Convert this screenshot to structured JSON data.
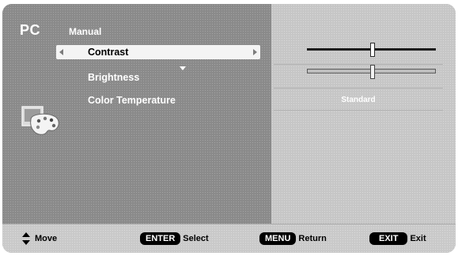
{
  "osd": {
    "source": "PC",
    "mode": "Manual",
    "menu_items": [
      {
        "label": "Contrast"
      },
      {
        "label": "Brightness"
      },
      {
        "label": "Color Temperature"
      }
    ],
    "sliders": [
      {
        "name": "contrast",
        "level_percent": 50,
        "active": true
      },
      {
        "name": "brightness",
        "level_percent": 50,
        "active": false
      }
    ],
    "color_temperature_value": "Standard"
  },
  "footer": {
    "move_label": "Move",
    "enter_key": "ENTER",
    "enter_label": "Select",
    "menu_key": "MENU",
    "menu_label": "Return",
    "exit_key": "EXIT",
    "exit_label": "Exit"
  },
  "icons": [
    "palette-icon",
    "up-down-arrow-icon",
    "arrow-left-icon",
    "arrow-right-icon",
    "arrow-down-icon"
  ]
}
